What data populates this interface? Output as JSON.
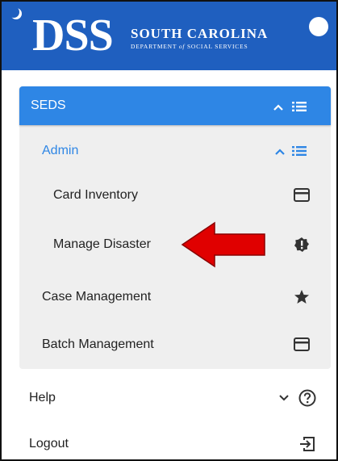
{
  "header": {
    "logo_text": "DSS",
    "logo_subtitle": "SOUTH CAROLINA",
    "logo_department_pre": "DEPARTMENT ",
    "logo_department_of": "of",
    "logo_department_post": " SOCIAL SERVICES",
    "brand_color": "#1f5fbf"
  },
  "menu": {
    "section": {
      "label": "SEDS",
      "expanded": true,
      "color": "#2e86e5"
    },
    "admin": {
      "label": "Admin",
      "expanded": true,
      "items": [
        {
          "label": "Card Inventory",
          "icon": "credit-card-icon"
        },
        {
          "label": "Manage Disaster",
          "icon": "gear-badge-icon"
        }
      ]
    },
    "items": [
      {
        "label": "Case Management",
        "icon": "star-icon"
      },
      {
        "label": "Batch Management",
        "icon": "credit-card-icon"
      }
    ],
    "footer": [
      {
        "label": "Help",
        "icon": "help-circle-icon",
        "chevron": "down"
      },
      {
        "label": "Logout",
        "icon": "logout-icon"
      }
    ]
  },
  "annotation": {
    "arrow_color": "#e00000",
    "points_to": "Manage Disaster"
  }
}
